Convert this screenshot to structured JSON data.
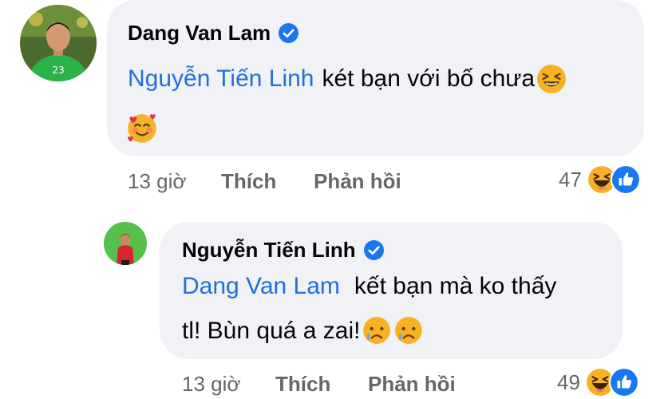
{
  "comments": [
    {
      "author": "Dang Van Lam",
      "mention": "Nguyễn Tiến Linh",
      "text_line1": "két bạn với bố chưa",
      "time": "13 giờ",
      "like_label": "Thích",
      "reply_label": "Phản hồi",
      "reaction_count": "47",
      "reactions": [
        "haha-icon",
        "like-icon"
      ]
    },
    {
      "author": "Nguyễn Tiến Linh",
      "mention": "Dang Van Lam",
      "text_line1": "kết bạn mà ko thấy",
      "text_line2": "tl! Bùn quá a zai!",
      "time": "13 giờ",
      "like_label": "Thích",
      "reply_label": "Phản hồi",
      "reaction_count": "49",
      "reactions": [
        "haha-icon",
        "like-icon"
      ]
    }
  ],
  "colors": {
    "bubble": "#f0f2f5",
    "mention": "#216fdb",
    "meta": "#65676b",
    "verified": "#1877f2",
    "like": "#1877f2",
    "emoji": "#f7b125"
  }
}
